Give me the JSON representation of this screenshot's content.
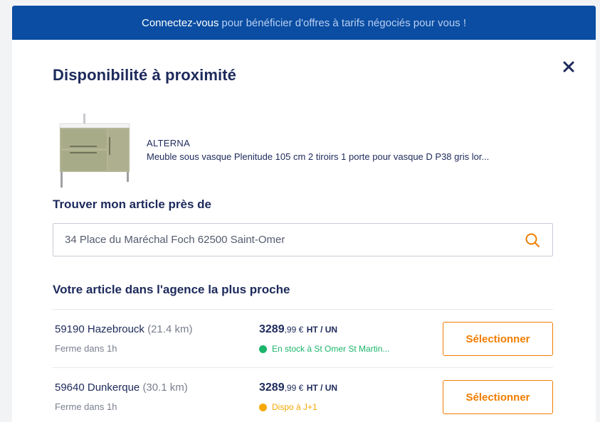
{
  "banner": {
    "strong": "Connectez-vous",
    "rest": "pour bénéficier d'offres à tarifs négociés pour vous !"
  },
  "modal": {
    "title": "Disponibilité à proximité",
    "close_icon": "close-icon"
  },
  "product": {
    "image_icon": "vanity-cabinet-image",
    "brand": "ALTERNA",
    "description": "Meuble sous vasque Plenitude 105 cm 2 tiroirs 1 porte pour vasque D P38 gris lor..."
  },
  "search": {
    "label": "Trouver mon article près de",
    "value": "34 Place du Maréchal Foch 62500 Saint-Omer",
    "icon": "search-icon"
  },
  "results": {
    "title": "Votre article dans l'agence la plus proche",
    "rows": [
      {
        "agency": "59190 Hazebrouck",
        "distance": "(21.4 km)",
        "closing": "Ferme dans 1h",
        "price_int": "3289",
        "price_dec": ",99 €",
        "price_unit": "HT / UN",
        "stock": "En stock à St Omer St Martin...",
        "stock_color": "#1bb56a",
        "button": "Sélectionner"
      },
      {
        "agency": "59640 Dunkerque",
        "distance": "(30.1 km)",
        "closing": "Ferme dans 1h",
        "price_int": "3289",
        "price_dec": ",99 €",
        "price_unit": "HT / UN",
        "stock": "Dispo à J+1",
        "stock_color": "#f5a800",
        "button": "Sélectionner"
      }
    ]
  },
  "colors": {
    "brand_blue": "#0a4da2",
    "navy_text": "#1d2a5b",
    "accent_orange": "#f07d00"
  }
}
